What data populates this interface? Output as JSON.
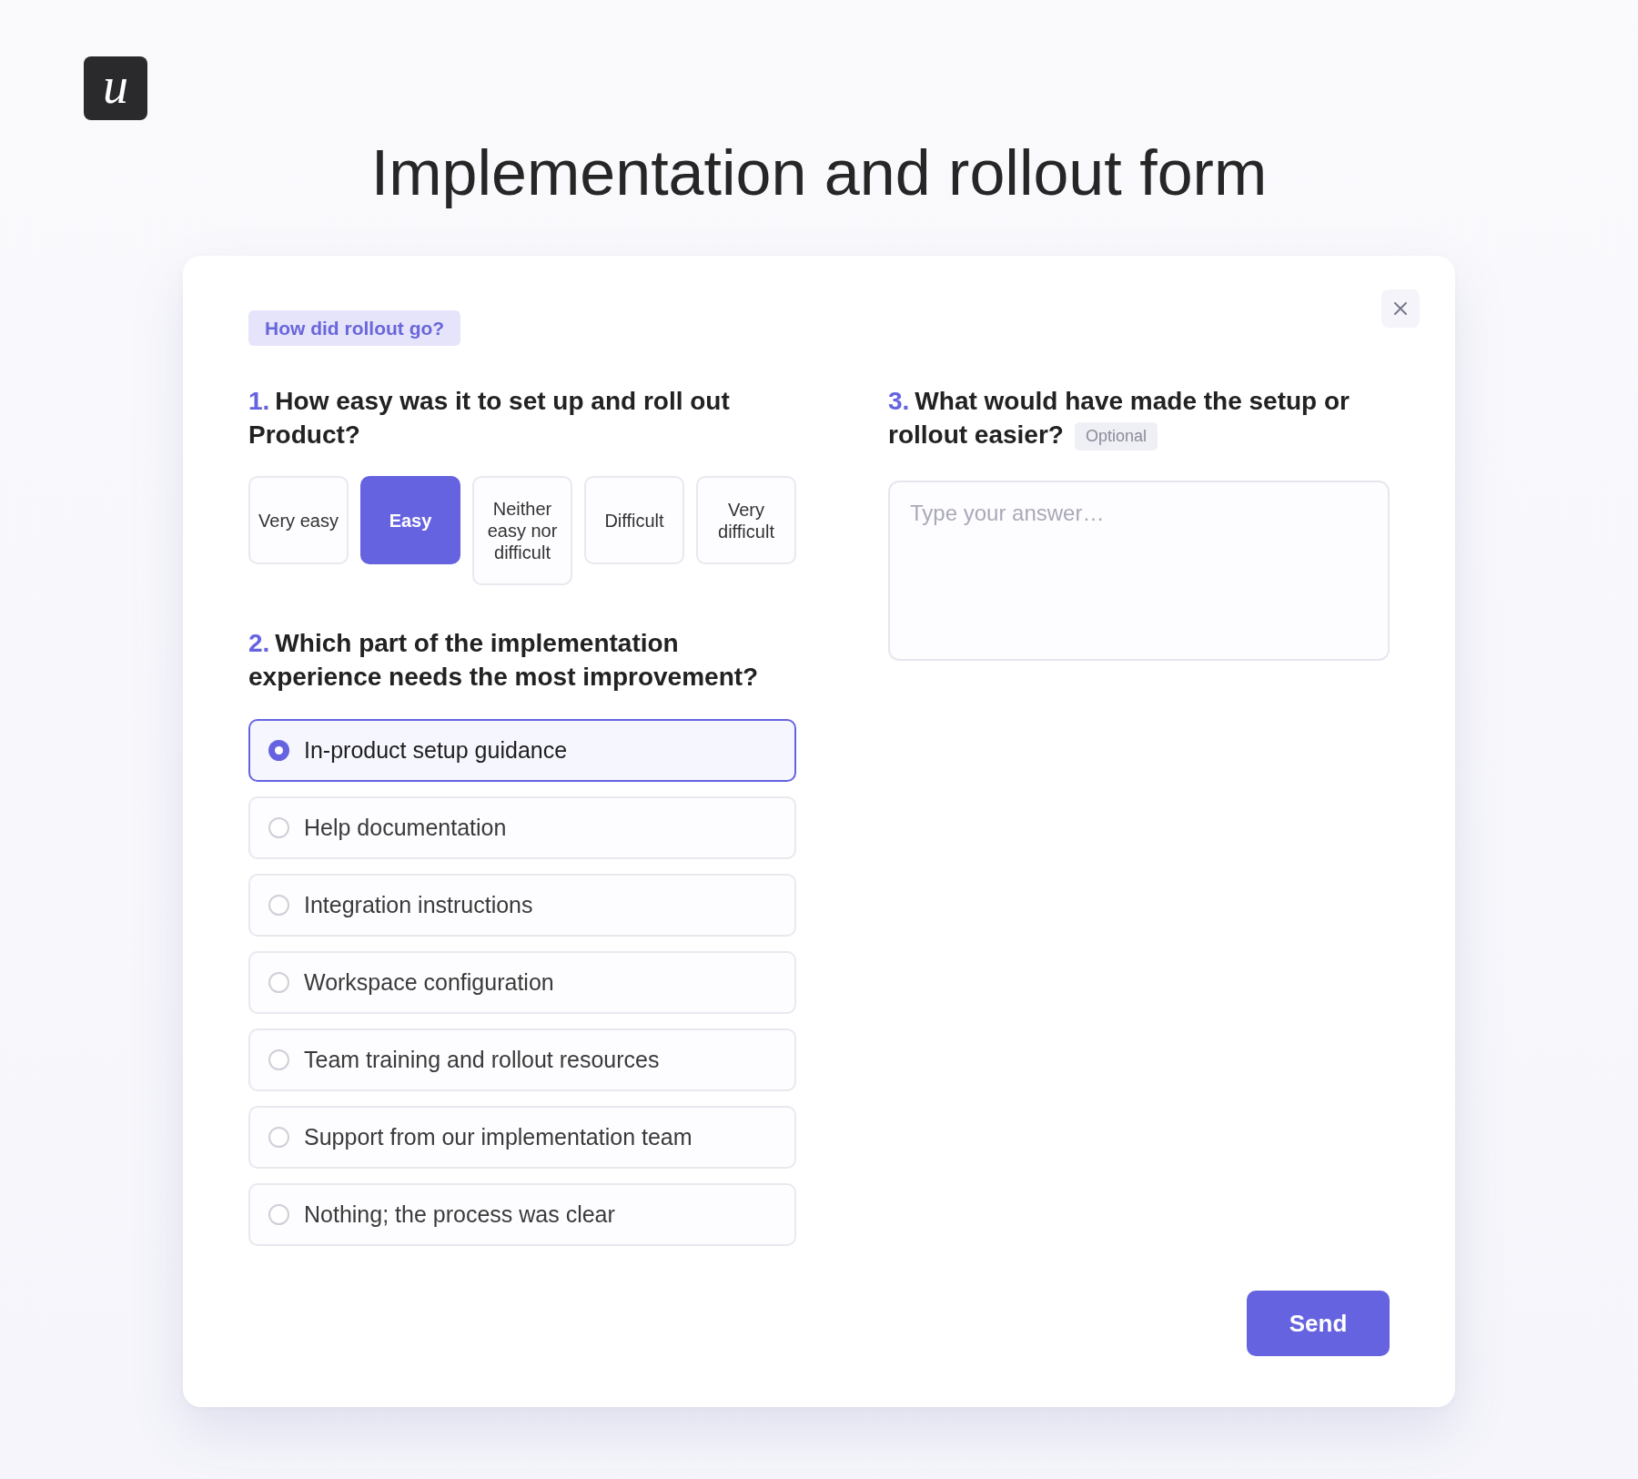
{
  "logo": {
    "mark": "u"
  },
  "title": "Implementation and rollout form",
  "dialog": {
    "tag": "How did rollout go?",
    "columns": [
      [
        {
          "kind": "scale",
          "number": "1.",
          "text": "How easy was it to set up and roll out Product?",
          "options": [
            {
              "label": "Very easy",
              "selected": false
            },
            {
              "label": "Easy",
              "selected": true
            },
            {
              "label": "Neither easy nor difficult",
              "selected": false
            },
            {
              "label": "Difficult",
              "selected": false
            },
            {
              "label": "Very difficult",
              "selected": false
            }
          ]
        },
        {
          "kind": "choice",
          "number": "2.",
          "text": "Which part of the implementation experience needs the most improvement?",
          "options": [
            {
              "label": "In-product setup guidance",
              "selected": true
            },
            {
              "label": "Help documentation",
              "selected": false
            },
            {
              "label": "Integration instructions",
              "selected": false
            },
            {
              "label": "Workspace configuration",
              "selected": false
            },
            {
              "label": "Team training and rollout resources",
              "selected": false
            },
            {
              "label": "Support from our implementation team",
              "selected": false
            },
            {
              "label": "Nothing; the process was clear",
              "selected": false
            }
          ]
        }
      ],
      [
        {
          "kind": "text",
          "number": "3.",
          "text": "What would have made the setup or rollout easier?",
          "badge": "Optional",
          "placeholder": "Type your answer…"
        }
      ]
    ],
    "submit": "Send"
  }
}
